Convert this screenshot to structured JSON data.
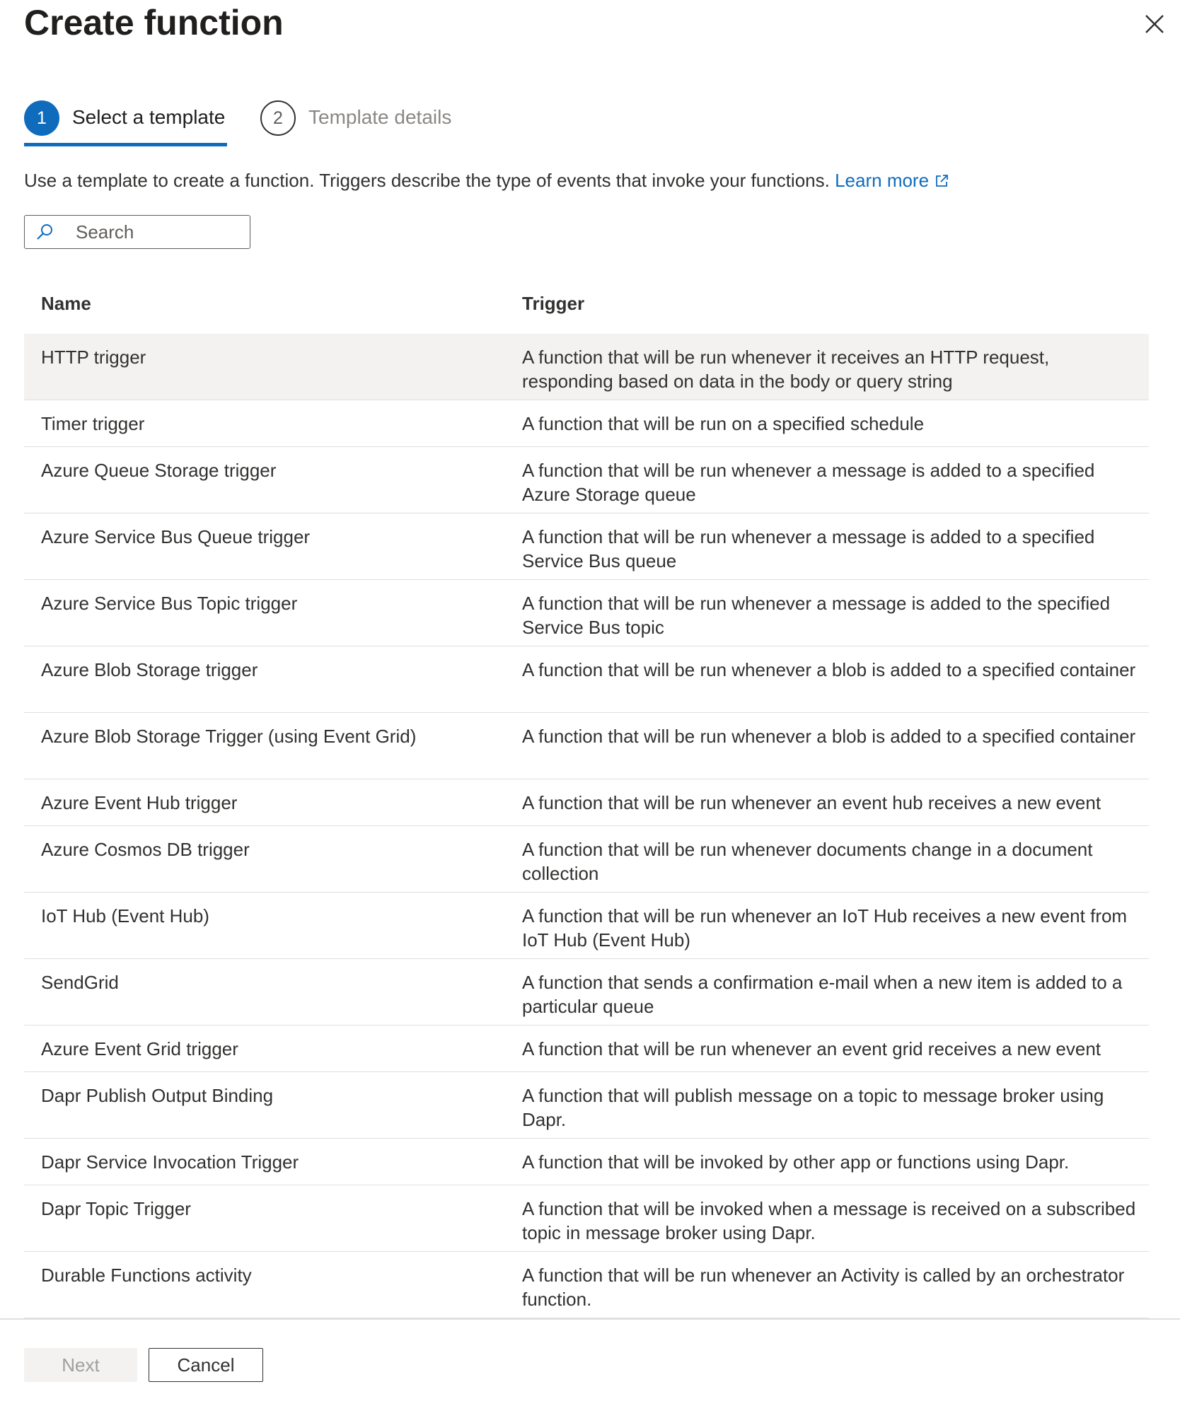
{
  "dialog": {
    "title": "Create function"
  },
  "steps": [
    {
      "number": "1",
      "label": "Select a template",
      "state": "active"
    },
    {
      "number": "2",
      "label": "Template details",
      "state": "inactive"
    }
  ],
  "intro": {
    "text": "Use a template to create a function. Triggers describe the type of events that invoke your functions.",
    "link_text": "Learn more"
  },
  "search": {
    "placeholder": "Search",
    "value": ""
  },
  "table": {
    "headers": {
      "name": "Name",
      "trigger": "Trigger"
    },
    "rows": [
      {
        "name": "HTTP trigger",
        "trigger": "A function that will be run whenever it receives an HTTP request, responding based on data in the body or query string",
        "selected": true
      },
      {
        "name": "Timer trigger",
        "trigger": "A function that will be run on a specified schedule"
      },
      {
        "name": "Azure Queue Storage trigger",
        "trigger": "A function that will be run whenever a message is added to a specified Azure Storage queue"
      },
      {
        "name": "Azure Service Bus Queue trigger",
        "trigger": "A function that will be run whenever a message is added to a specified Service Bus queue"
      },
      {
        "name": "Azure Service Bus Topic trigger",
        "trigger": "A function that will be run whenever a message is added to the specified Service Bus topic"
      },
      {
        "name": "Azure Blob Storage trigger",
        "trigger": "A function that will be run whenever a blob is added to a specified container"
      },
      {
        "name": "Azure Blob Storage Trigger (using Event Grid)",
        "trigger": "A function that will be run whenever a blob is added to a specified container"
      },
      {
        "name": "Azure Event Hub trigger",
        "trigger": "A function that will be run whenever an event hub receives a new event"
      },
      {
        "name": "Azure Cosmos DB trigger",
        "trigger": "A function that will be run whenever documents change in a document collection"
      },
      {
        "name": "IoT Hub (Event Hub)",
        "trigger": "A function that will be run whenever an IoT Hub receives a new event from IoT Hub (Event Hub)"
      },
      {
        "name": "SendGrid",
        "trigger": "A function that sends a confirmation e-mail when a new item is added to a particular queue"
      },
      {
        "name": "Azure Event Grid trigger",
        "trigger": "A function that will be run whenever an event grid receives a new event"
      },
      {
        "name": "Dapr Publish Output Binding",
        "trigger": "A function that will publish message on a topic to message broker using Dapr."
      },
      {
        "name": "Dapr Service Invocation Trigger",
        "trigger": "A function that will be invoked by other app or functions using Dapr."
      },
      {
        "name": "Dapr Topic Trigger",
        "trigger": "A function that will be invoked when a message is received on a subscribed topic in message broker using Dapr."
      },
      {
        "name": "Durable Functions activity",
        "trigger": "A function that will be run whenever an Activity is called by an orchestrator function."
      }
    ]
  },
  "footer": {
    "next_label": "Next",
    "cancel_label": "Cancel"
  },
  "colors": {
    "accent": "#0f6cbd",
    "selected_row": "#f3f2f1",
    "divider": "#e1dfdd"
  },
  "icons": [
    "close-icon",
    "external-link-icon",
    "search-icon"
  ]
}
